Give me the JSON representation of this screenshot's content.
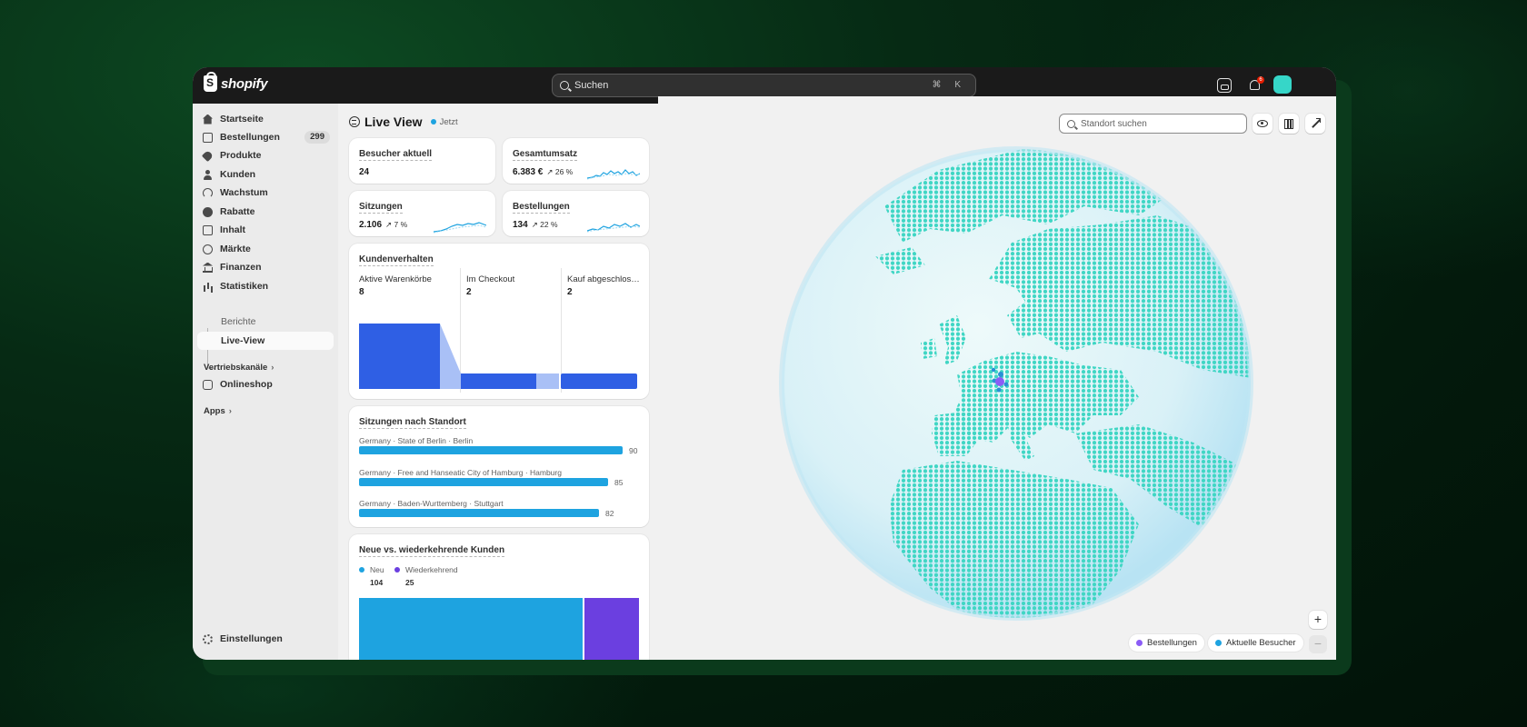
{
  "app": {
    "brand": "shopify",
    "search_placeholder": "Suchen",
    "search_shortcut": "⌘ K",
    "notification_count": "6",
    "accent": "#36d6c8"
  },
  "sidebar": {
    "items": [
      {
        "label": "Startseite",
        "icon": "home-icon"
      },
      {
        "label": "Bestellungen",
        "icon": "inbox-icon",
        "badge": "299"
      },
      {
        "label": "Produkte",
        "icon": "tag-icon"
      },
      {
        "label": "Kunden",
        "icon": "person-icon"
      },
      {
        "label": "Wachstum",
        "icon": "gauge-icon"
      },
      {
        "label": "Rabatte",
        "icon": "discount-icon"
      },
      {
        "label": "Inhalt",
        "icon": "content-icon"
      },
      {
        "label": "Märkte",
        "icon": "globe-icon"
      },
      {
        "label": "Finanzen",
        "icon": "bank-icon"
      },
      {
        "label": "Statistiken",
        "icon": "chart-icon"
      }
    ],
    "sub_items": [
      {
        "label": "Berichte"
      },
      {
        "label": "Live-View"
      }
    ],
    "sales_channels_label": "Vertriebskanäle",
    "online_store_label": "Onlineshop",
    "apps_label": "Apps",
    "settings_label": "Einstellungen"
  },
  "page": {
    "title": "Live View",
    "status": "Jetzt"
  },
  "metrics": [
    {
      "title": "Besucher aktuell",
      "value": "24",
      "delta": ""
    },
    {
      "title": "Gesamtumsatz",
      "value": "6.383 €",
      "delta": "↗ 26 %"
    },
    {
      "title": "Sitzungen",
      "value": "2.106",
      "delta": "↗ 7 %"
    },
    {
      "title": "Bestellungen",
      "value": "134",
      "delta": "↗ 22 %"
    }
  ],
  "behavior": {
    "title": "Kundenverhalten",
    "stages": [
      {
        "label": "Aktive Warenkörbe",
        "value": "8"
      },
      {
        "label": "Im Checkout",
        "value": "2"
      },
      {
        "label": "Kauf abgeschlos…",
        "value": "2"
      }
    ]
  },
  "locations": {
    "title": "Sitzungen nach Standort",
    "max": 90,
    "rows": [
      {
        "label": "Germany · State of Berlin · Berlin",
        "value": "90"
      },
      {
        "label": "Germany · Free and Hanseatic City of Hamburg · Hamburg",
        "value": "85"
      },
      {
        "label": "Germany · Baden-Wurttemberg · Stuttgart",
        "value": "82"
      }
    ]
  },
  "customers": {
    "title": "Neue vs. wiederkehrende Kunden",
    "new_label": "Neu",
    "new_value": "104",
    "returning_label": "Wiederkehrend",
    "returning_value": "25",
    "new_color": "#1ea3e0",
    "returning_color": "#6b3fe0"
  },
  "map": {
    "search_placeholder": "Standort suchen",
    "legend_orders": "Bestellungen",
    "legend_visitors": "Aktuelle Besucher",
    "zoom_in": "+",
    "zoom_out": "−",
    "orders_color": "#8b5cf6",
    "visitors_color": "#1ea3e0",
    "land_color": "#3fd6c4"
  }
}
